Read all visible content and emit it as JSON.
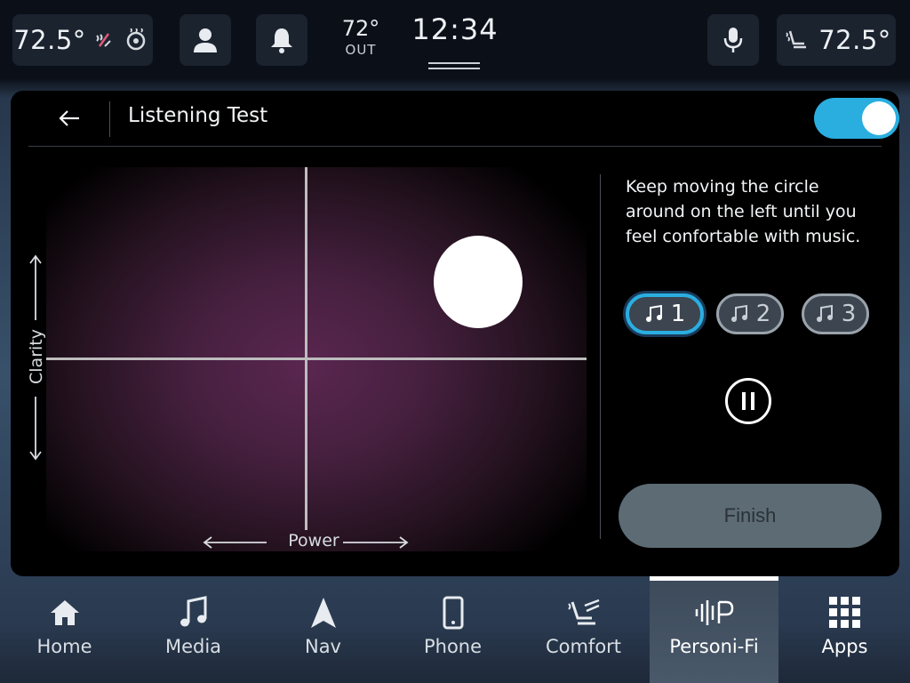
{
  "status_bar": {
    "driver_temp": "72.5°",
    "passenger_temp": "72.5°",
    "outside_temp": "72°",
    "outside_label": "OUT",
    "time": "12:34"
  },
  "header": {
    "title": "Listening Test",
    "toggle_on": true
  },
  "plot": {
    "x_label": "Power",
    "y_label": "Clarity"
  },
  "instructions": "Keep moving the circle around on the left until you feel confortable with  music.",
  "tracks": [
    {
      "label": "1",
      "selected": true
    },
    {
      "label": "2",
      "selected": false
    },
    {
      "label": "3",
      "selected": false
    }
  ],
  "finish_label": "Finish",
  "nav": [
    {
      "label": "Home",
      "icon": "home-icon"
    },
    {
      "label": "Media",
      "icon": "music-note-icon"
    },
    {
      "label": "Nav",
      "icon": "navigation-arrow-icon"
    },
    {
      "label": "Phone",
      "icon": "phone-icon"
    },
    {
      "label": "Comfort",
      "icon": "comfort-seat-icon"
    },
    {
      "label": "Personi-Fi",
      "icon": "personi-fi-icon",
      "active": true
    },
    {
      "label": "Apps",
      "icon": "apps-grid-icon"
    }
  ],
  "colors": {
    "accent": "#2aaee0",
    "panel": "#000000",
    "finish_button": "#5d6b74"
  }
}
